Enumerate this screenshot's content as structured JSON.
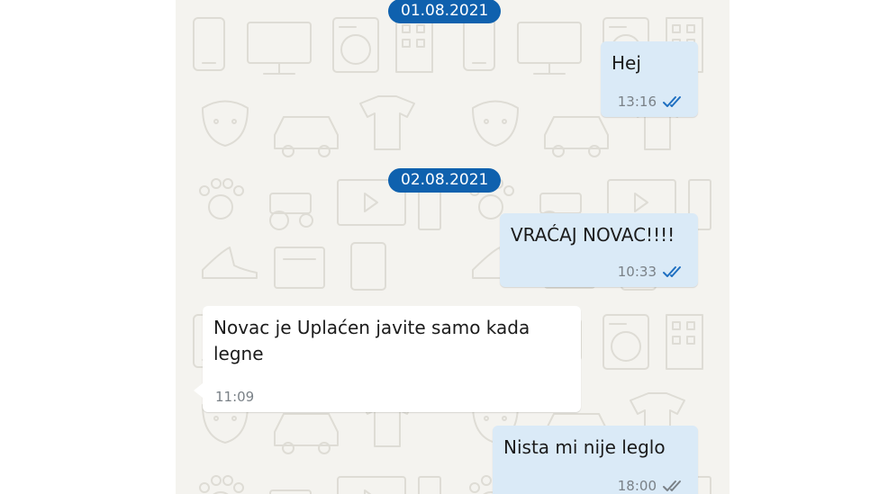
{
  "colors": {
    "date_pill": "#0f61ae",
    "outgoing_bubble": "#daeaf7",
    "incoming_bubble": "#ffffff",
    "wallpaper": "#f4f3ef",
    "read_ticks": "#1e6fc1",
    "delivered_ticks": "#7a8187"
  },
  "dates": [
    "01.08.2021",
    "02.08.2021"
  ],
  "messages": [
    {
      "direction": "out",
      "text": "Hej",
      "time": "13:16",
      "status": "read-ticks-icon"
    },
    {
      "direction": "out",
      "text": "VRAĆAJ NOVAC!!!!",
      "time": "10:33",
      "status": "read-ticks-icon"
    },
    {
      "direction": "in",
      "text": "Novac je Uplaćen javite samo kada legne",
      "time": "11:09"
    },
    {
      "direction": "out",
      "text": "Nista mi nije leglo",
      "time": "18:00",
      "status": "delivered-ticks-icon"
    }
  ]
}
